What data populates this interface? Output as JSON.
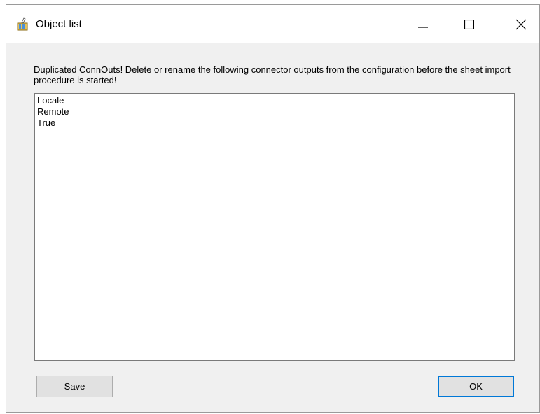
{
  "window": {
    "title": "Object list",
    "controls": {
      "minimize": "minimize-icon",
      "maximize": "maximize-icon",
      "close": "close-icon"
    }
  },
  "message": "Duplicated ConnOuts! Delete or rename the following connector outputs from the configuration before the sheet import procedure is started!",
  "list": {
    "items": [
      "Locale",
      "Remote",
      "True"
    ]
  },
  "buttons": {
    "save_label": "Save",
    "ok_label": "OK"
  },
  "colors": {
    "accent": "#0078d7",
    "window_bg": "#f0f0f0",
    "titlebar_bg": "#ffffff"
  }
}
